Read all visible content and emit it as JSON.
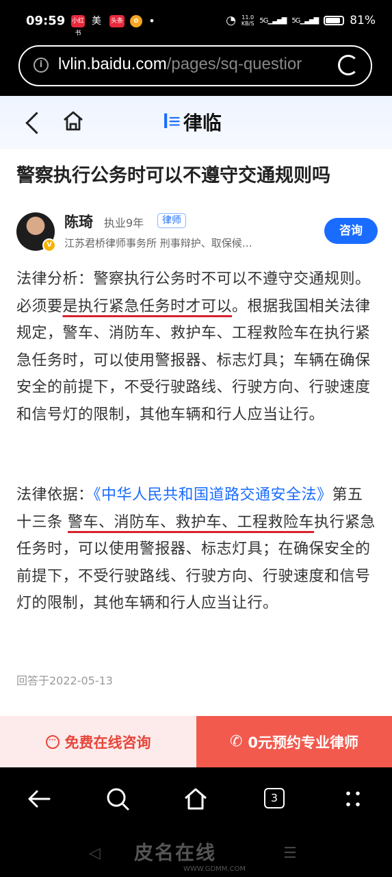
{
  "status_bar": {
    "time": "09:59",
    "app1": "小红书",
    "app2": "美",
    "app3": "头条",
    "dot": "•",
    "speed": "11.0\nKB/S",
    "signal1": "5G",
    "signal2": "5G",
    "battery_text": "81%",
    "battery_level": 0.81
  },
  "url_bar": {
    "host": "lvlin.baidu.com",
    "path": "/pages/sq-questior"
  },
  "nav": {
    "logo_mark": "l≡",
    "logo_text": "律临"
  },
  "article": {
    "title": "警察执行公务时可以不遵守交通规则吗",
    "lawyer": {
      "name": "陈琦",
      "years": "执业9年",
      "tag": "律师",
      "firm": "江苏君桥律师事务所  刑事辩护、取保候…",
      "consult_label": "咨询"
    },
    "analysis": {
      "part1": "法律分析：警察执行公务时不可以不遵守交通规则。必须要",
      "highlight": "是执行紧急任务时才可以",
      "part2": "。根据我国相关法律规定，警车、消防车、救护车、工程救险车在执行紧急任务时，可以使用警报器、标志灯具；车辆在确保安全的前提下，不受行驶路线、行驶方向、行驶速度和信号灯的限制，其他车辆和行人应当让行。"
    },
    "basis": {
      "label": "法律依据：",
      "law_link": "《中华人民共和国道路交通安全法》",
      "article_no": "第五十三条 ",
      "highlight": "警车、消防车、救护车、工程救险车",
      "rest": "执行紧急任务时，可以使用警报器、标志灯具；在确保安全的前提下，不受行驶路线、行驶方向、行驶速度和信号灯的限制，其他车辆和行人应当让行。"
    },
    "answered_at": "回答于2022-05-13"
  },
  "cta": {
    "free_consult": "免费在线咨询",
    "book_lawyer": "0元预约专业律师"
  },
  "browser_nav": {
    "tabs_count": "3"
  },
  "watermark": {
    "text": "皮名在线",
    "url": "WWW.GDMM.COM"
  },
  "colors": {
    "brand_blue": "#1a6cff",
    "cta_red": "#f25a4e",
    "cta_pink": "#fdeaea",
    "underline_red": "#d8202e"
  }
}
